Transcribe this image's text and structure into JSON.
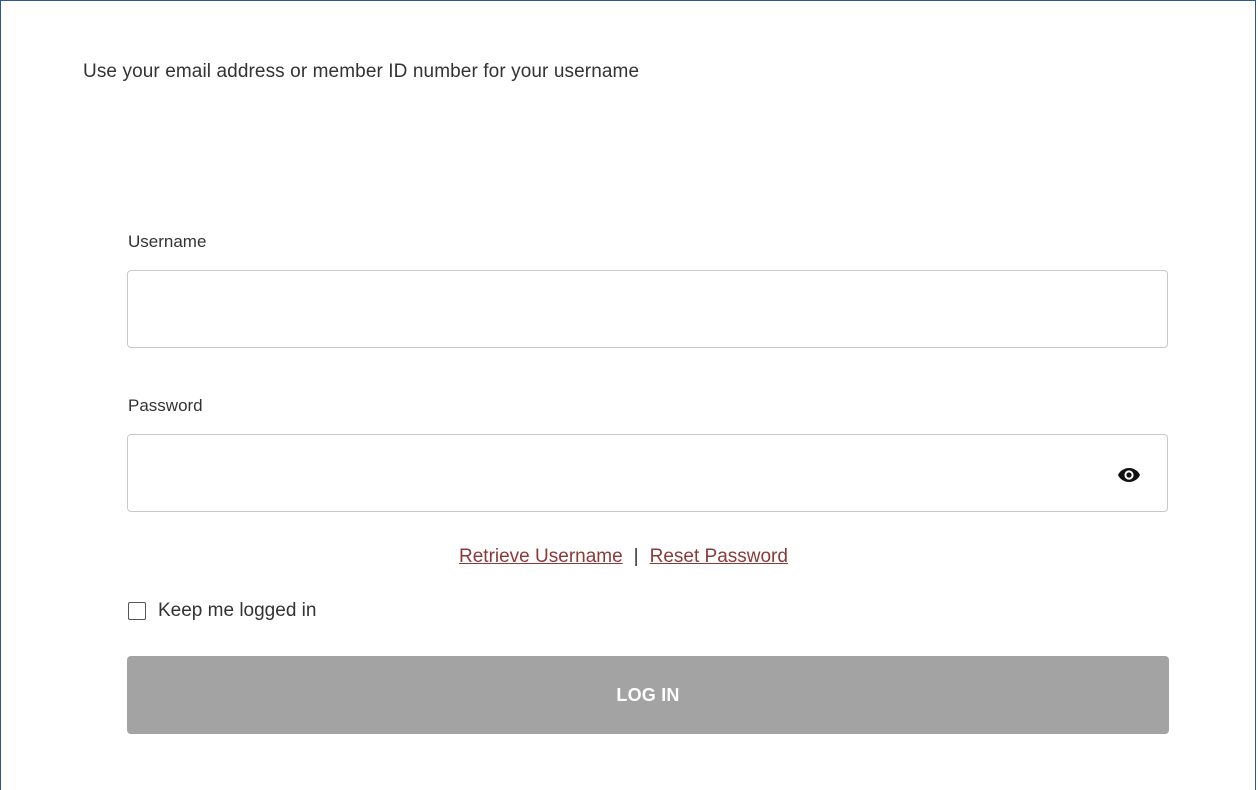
{
  "intro_text": "Use your email address or member ID number for your username",
  "username": {
    "label": "Username",
    "value": "",
    "placeholder": ""
  },
  "password": {
    "label": "Password",
    "value": "",
    "placeholder": "",
    "toggle_icon": "eye-icon"
  },
  "links": {
    "retrieve_username": "Retrieve Username",
    "separator": "|",
    "reset_password": "Reset Password"
  },
  "keep_logged_in": {
    "label": "Keep me logged in",
    "checked": false
  },
  "login_button": {
    "label": "LOG IN"
  },
  "colors": {
    "link": "#8b3a3a",
    "button_disabled": "#a3a3a3",
    "frame_border": "#2f5597"
  }
}
